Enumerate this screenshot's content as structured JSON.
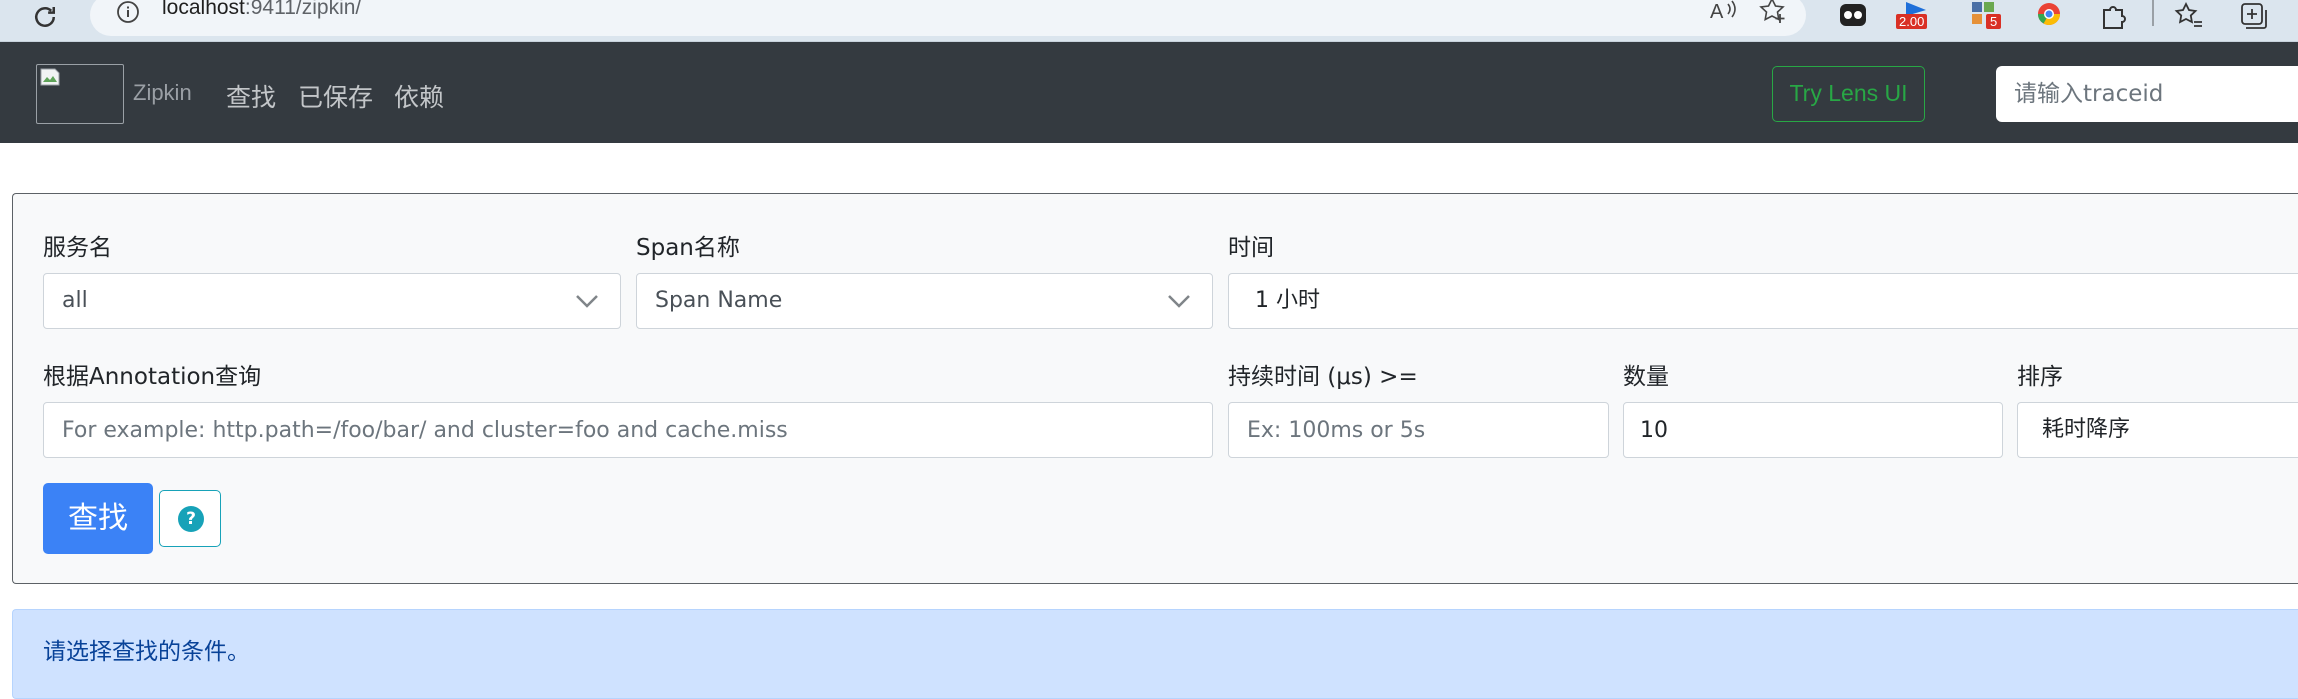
{
  "browser": {
    "url_host": "localhost",
    "url_rest": ":9411/zipkin/",
    "zoom_badge": "2.00",
    "ext_badge": "5"
  },
  "navbar": {
    "brand": "Zipkin",
    "links": [
      "查找",
      "已保存",
      "依赖"
    ],
    "lens_button": "Try Lens UI",
    "traceid_placeholder": "请输入traceid"
  },
  "search": {
    "service_label": "服务名",
    "service_value": "all",
    "span_label": "Span名称",
    "span_value": "Span Name",
    "time_label": "时间",
    "time_value": "1 小时",
    "annotation_label": "根据Annotation查询",
    "annotation_placeholder": "For example: http.path=/foo/bar/ and cluster=foo and cache.miss",
    "duration_label": "持续时间 (μs) >=",
    "duration_placeholder": "Ex: 100ms or 5s",
    "limit_label": "数量",
    "limit_value": "10",
    "sort_label": "排序",
    "sort_value": "耗时降序",
    "search_button": "查找",
    "help_icon_char": "?"
  },
  "alert": {
    "message": "请选择查找的条件。"
  }
}
